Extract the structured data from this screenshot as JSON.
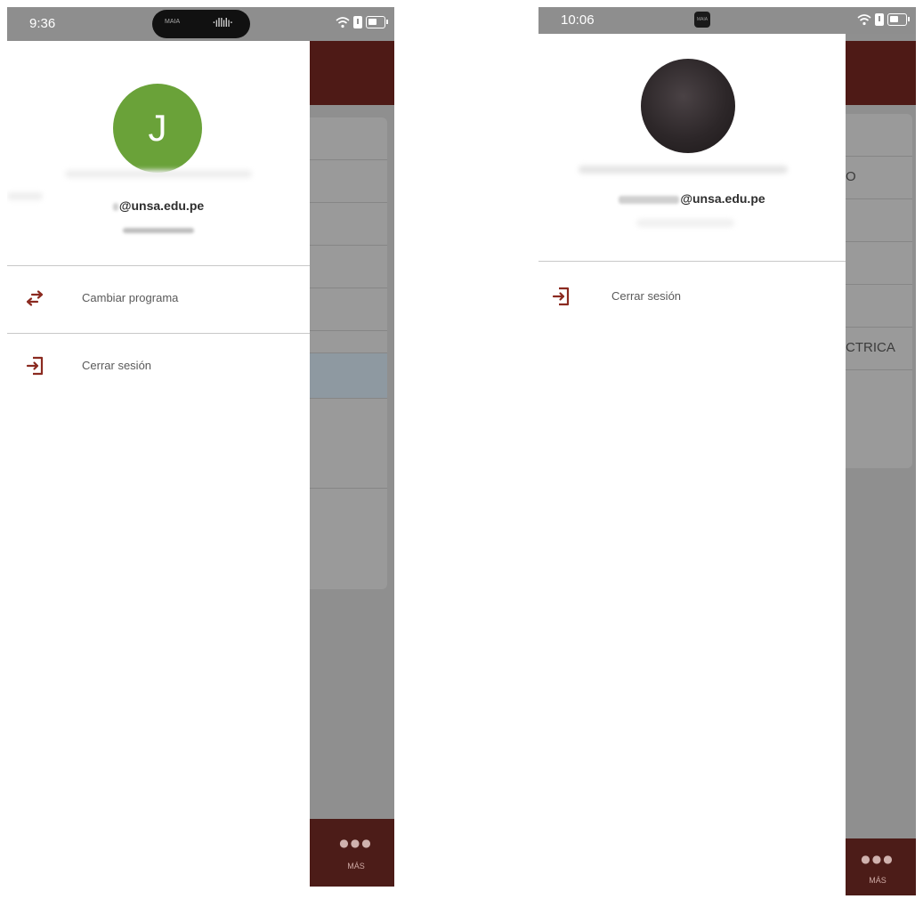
{
  "left_screen": {
    "status": {
      "time": "9:36",
      "island_app": "MAIA"
    },
    "background": {
      "more_label": "MÁS"
    },
    "profile": {
      "avatar_initial": "J",
      "email": "@unsa.edu.pe"
    },
    "menu": [
      {
        "label": "Cambiar programa",
        "icon": "swap-arrows-icon"
      },
      {
        "label": "Cerrar sesión",
        "icon": "logout-icon"
      }
    ]
  },
  "right_screen": {
    "status": {
      "time": "10:06",
      "island_app": "MAIA"
    },
    "background": {
      "row_text_1": "O",
      "row_text_2": "CTRICA",
      "more_label": "MÁS"
    },
    "profile": {
      "avatar": "profile-photo",
      "email": "@unsa.edu.pe"
    },
    "menu": [
      {
        "label": "Cerrar sesión",
        "icon": "logout-icon"
      }
    ]
  },
  "colors": {
    "brand_dark_red": "#4e1a16",
    "accent_icon": "#8b2a20",
    "avatar_green": "#6aa239"
  }
}
